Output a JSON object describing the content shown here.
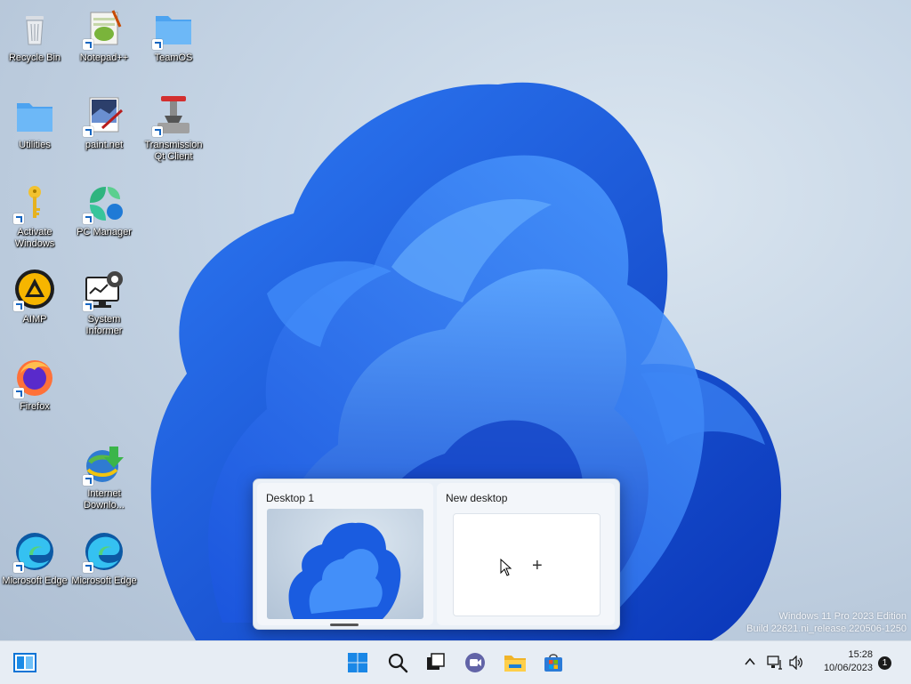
{
  "desktop": {
    "icons": [
      {
        "label": "Recycle Bin"
      },
      {
        "label": "Notepad++"
      },
      {
        "label": "TeamOS"
      },
      {
        "label": "Utilities"
      },
      {
        "label": "paint.net"
      },
      {
        "label": "Transmission Qt Client"
      },
      {
        "label": "Activate Windows"
      },
      {
        "label": "PC Manager"
      },
      {
        "label": "AIMP"
      },
      {
        "label": "System Informer"
      },
      {
        "label": "Firefox"
      },
      {
        "label": "Internet Downlo..."
      },
      {
        "label": "Microsoft Edge"
      },
      {
        "label": "Microsoft Edge"
      }
    ]
  },
  "watermark": {
    "line1": "Windows 11 Pro 2023 Edition",
    "line2": "Build 22621.ni_release.220506-1250"
  },
  "task_view": {
    "desktops": [
      {
        "title": "Desktop 1"
      },
      {
        "title": "New desktop"
      }
    ],
    "new_desktop_plus": "+"
  },
  "taskbar": {
    "clock_time": "15:28",
    "clock_date": "10/06/2023",
    "notification_count": "1",
    "icons": [
      "task-view-icon",
      "start-icon",
      "search-icon",
      "task-switch-icon",
      "teams-chat-icon",
      "file-explorer-icon",
      "microsoft-store-icon"
    ],
    "tray_icons": [
      "chevron-up-icon",
      "network-icon",
      "volume-icon"
    ]
  },
  "colors": {
    "bloom_blue": "#1a5ce0",
    "bloom_dark": "#0b2ea8",
    "taskbar_bg": "#e7edf4",
    "accent": "#0067c0"
  }
}
